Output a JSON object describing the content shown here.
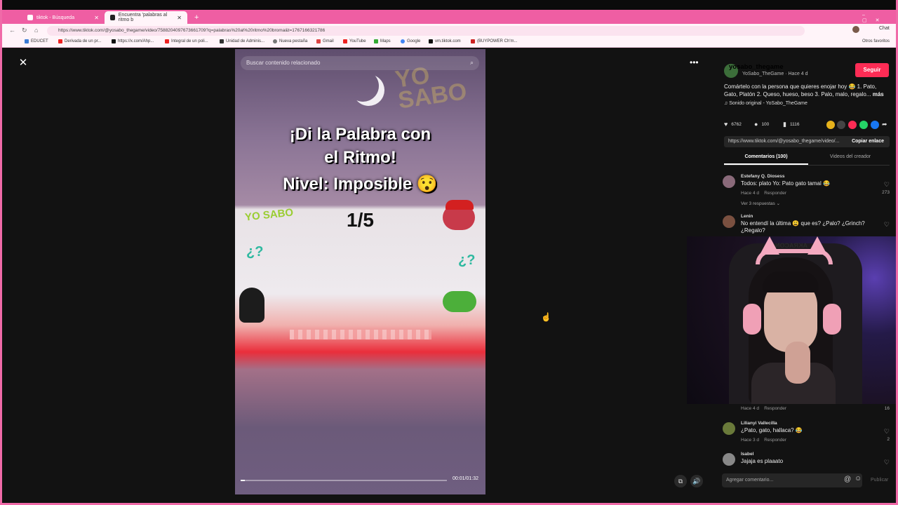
{
  "browser": {
    "tabs": [
      {
        "title": "tiktok - Búsqueda"
      },
      {
        "title": "Encuentra 'palabras al ritmo b"
      }
    ],
    "url": "https://www.tiktok.com/@yosabo_thegame/video/7588204097673661709?q=palabras%20al%20ritmo%20broma&t=1767166321786",
    "bookmarks": [
      "EDUCET",
      "Derivada de un pr...",
      "https://x.com/Ahp...",
      "Integral de un poli...",
      "Unidad de Adminis...",
      "Nueva pestaña",
      "Gmail",
      "YouTube",
      "Maps",
      "Google",
      "vm.tiktok.com",
      "(BUYPOWER Ch'm..."
    ],
    "other_favorites": "Otros favoritos",
    "chat_label": "Chat",
    "accent_color": "#ef5ea3"
  },
  "video": {
    "search_placeholder": "Buscar contenido relacionado",
    "logo_text": "YO SABO",
    "title_line1": "¡Di la Palabra con",
    "title_line2": "el Ritmo!",
    "title_line3": "Nivel: Imposible 😯",
    "counter": "1/5",
    "qmark_left": "¿?",
    "qmark_right": "¿?",
    "time": "00:01/01:32",
    "progress": 0.02
  },
  "panel": {
    "username": "yosabo_thegame",
    "subline": "YoSabo_TheGame · Hace 4 d",
    "follow_label": "Seguir",
    "description": "Comártelo con la persona que quieres enojar hoy 😂 1. Pato, Gato, Platón 2. Queso, hueso, beso 3. Palo, malo, regalo...",
    "more_label": "más",
    "sound": "Sonido original - YoSabo_TheGame",
    "likes": "6762",
    "comments": "100",
    "saves": "1116",
    "link": "https://www.tiktok.com/@yosabo_thegame/video/...",
    "copy_link": "Copiar enlace",
    "tab_comments": "Comentarios (100)",
    "tab_creator": "Videos del creador",
    "comment_list": [
      {
        "name": "Estefany Q. Diosess",
        "text": "Todos: plato Yo: Pato gato tamal 😂",
        "time": "Hace 4 d",
        "reply": "Responder",
        "likes": "273"
      },
      {
        "name": "Lenin",
        "text": "No entendí la última 😩 que es? ¿Palo? ¿Grinch? ¿Regalo?",
        "time": "Hace 4 d",
        "reply": "Responder",
        "likes": "16"
      },
      {
        "name": "Lilianyi Vallecilla",
        "text": "¿Pato, gato, hallaca? 😂",
        "time": "Hace 3 d",
        "reply": "Responder",
        "likes": "2"
      },
      {
        "name": "Isabel",
        "text": "Jajaja es plaaato",
        "time": "",
        "reply": "",
        "likes": ""
      }
    ],
    "view_replies": "Ver 3 respuestas",
    "input_placeholder": "Agregar comentario...",
    "publish": "Publicar",
    "follow_color": "#fe2c55"
  },
  "webcam": {
    "headset_text": "AKRACON"
  }
}
